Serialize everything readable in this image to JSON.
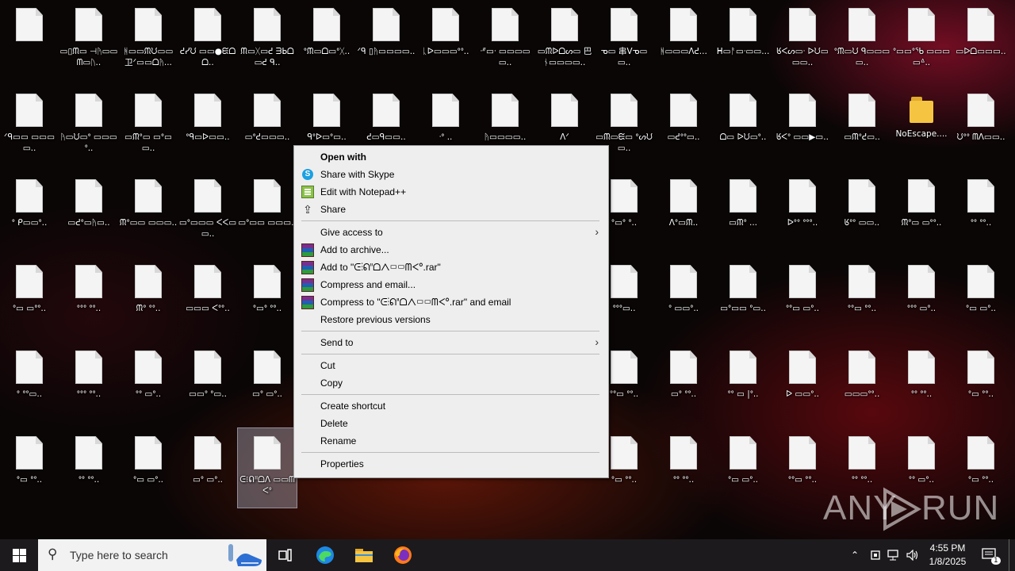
{
  "desktop": {
    "icons": [
      {
        "label": "",
        "type": "file",
        "col": 0,
        "row": 0,
        "blurred": true
      },
      {
        "label": "▭▯ᙏ▭ ⊣ᚤ▭▭ᗰ▭ᚢ..",
        "type": "file",
        "col": 1,
        "row": 0
      },
      {
        "label": "ᚻ▭▭ᙏᙀ▭▭ 卫ᐟ▭▭ᗝᚤ...",
        "type": "file",
        "col": 2,
        "row": 0
      },
      {
        "label": "ᕍᓯᙀ ▭▭●ᙓᗝᗝ..",
        "type": "file",
        "col": 3,
        "row": 0
      },
      {
        "label": "ᙏ▭ᚷ▭ᕍ ᗱᖯᗝ▭ᕍ ᑫ..",
        "type": "file",
        "col": 4,
        "row": 0
      },
      {
        "label": "ᐤᙏ▭ᗝ▭ᐤᚷ..",
        "type": "file",
        "col": 5,
        "row": 0
      },
      {
        "label": "ᐟᑫ ▯ᚤ▭▭▭▭..",
        "type": "file",
        "col": 6,
        "row": 0
      },
      {
        "label": "ᚳᐅ▭▭▭ᐤᐤ..",
        "type": "file",
        "col": 7,
        "row": 0
      },
      {
        "label": "ᐧᐥ▭ᐧ ▭▭▭▭▭..",
        "type": "file",
        "col": 8,
        "row": 0
      },
      {
        "label": "▭ᙏᐅᗝᔕ▭ 巴ᚾ▭▭▭▭..",
        "type": "file",
        "col": 9,
        "row": 0
      },
      {
        "label": "ᓀ▭ 串ᐯᓀ▭▭..",
        "type": "file",
        "col": 10,
        "row": 0
      },
      {
        "label": "ᚻ▭▭▭ᐱᕍ...",
        "type": "file",
        "col": 11,
        "row": 0
      },
      {
        "label": "ᕼ▭ᚨ▭ᐧ▭▭...",
        "type": "file",
        "col": 12,
        "row": 0
      },
      {
        "label": "ᖉᐸᔕ▭ᐧ ᐅᙀ▭▭▭..",
        "type": "file",
        "col": 13,
        "row": 0
      },
      {
        "label": "ᐤᙏ▭ᙀ ᑫ▭▭▭▭..",
        "type": "file",
        "col": 14,
        "row": 0
      },
      {
        "label": "ᐤ▭▭ᐤᖃ ▭▭▭▭ᐞ..",
        "type": "file",
        "col": 15,
        "row": 0
      },
      {
        "label": "▭ᐅᗝ▭▭▭..",
        "type": "file",
        "col": 16,
        "row": 0
      },
      {
        "label": "ᐟᑫ▭▭ ▭▭▭▭..",
        "type": "file",
        "col": 0,
        "row": 1
      },
      {
        "label": "ᚤ▭ᙀ▭ᐤ ▭▭▭ᐤ..",
        "type": "file",
        "col": 1,
        "row": 1
      },
      {
        "label": "▭ᙏᐤ▭ ▭ᐤ▭▭..",
        "type": "file",
        "col": 2,
        "row": 1
      },
      {
        "label": "ᐤᑫ▭ᐅ▭▭..",
        "type": "file",
        "col": 3,
        "row": 1
      },
      {
        "label": "▭ᐤᕍ▭▭▭..",
        "type": "file",
        "col": 4,
        "row": 1
      },
      {
        "label": "ᑫᐤᐅ▭ᐤ▭..",
        "type": "file",
        "col": 5,
        "row": 1
      },
      {
        "label": "ᕍ▭ᑫ▭▭..",
        "type": "file",
        "col": 6,
        "row": 1
      },
      {
        "label": "ᐧᐤ ..",
        "type": "file",
        "col": 7,
        "row": 1
      },
      {
        "label": "ᚤ▭▭▭▭..",
        "type": "file",
        "col": 8,
        "row": 1
      },
      {
        "label": "ᐱᐟ",
        "type": "file",
        "col": 9,
        "row": 1
      },
      {
        "label": "▭ᙏ▭ᙓ▭ ᐤᔕᙀ▭..",
        "type": "file",
        "col": 10,
        "row": 1
      },
      {
        "label": "▭ᕍᐤᐤ▭..",
        "type": "file",
        "col": 11,
        "row": 1
      },
      {
        "label": "ᗝ▭ ᐅᙀ▭ᐤ..",
        "type": "file",
        "col": 12,
        "row": 1
      },
      {
        "label": "ᖉᐸᐤ ▭▭▶▭..",
        "type": "file",
        "col": 13,
        "row": 1
      },
      {
        "label": "▭ᙏᐤᕍ▭..",
        "type": "file",
        "col": 14,
        "row": 1
      },
      {
        "label": "NoEscape....",
        "type": "folder",
        "col": 15,
        "row": 1
      },
      {
        "label": "ᙀᐤᐤ ᗰᐱ▭▭..",
        "type": "file",
        "col": 16,
        "row": 1
      },
      {
        "label": "ᐤ ᑭ▭▭ᐤ..",
        "type": "file",
        "col": 0,
        "row": 2
      },
      {
        "label": "▭ᕍᐤ▭ᚤ▭..",
        "type": "file",
        "col": 1,
        "row": 2
      },
      {
        "label": "ᙏᐤ▭▭ ▭▭▭..",
        "type": "file",
        "col": 2,
        "row": 2
      },
      {
        "label": "▭ᐤ▭▭▭ ᐸᐸ▭▭..",
        "type": "file",
        "col": 3,
        "row": 2
      },
      {
        "label": "▭ᐤ▭▭ ▭▭▭..",
        "type": "file",
        "col": 4,
        "row": 2
      },
      {
        "label": "ᐤ▭ᐤ ᐤ..",
        "type": "file",
        "col": 10,
        "row": 2
      },
      {
        "label": "ᐱᐤ▭ᙏ..",
        "type": "file",
        "col": 11,
        "row": 2
      },
      {
        "label": "▭ᙏᐤ ...",
        "type": "file",
        "col": 12,
        "row": 2
      },
      {
        "label": "ᐅᐤᐤ ᐤᐤᐤ..",
        "type": "file",
        "col": 13,
        "row": 2
      },
      {
        "label": "ᖉᐤᐤ ▭▭..",
        "type": "file",
        "col": 14,
        "row": 2
      },
      {
        "label": "ᙏᐤ▭ ▭ᐤᐤ..",
        "type": "file",
        "col": 15,
        "row": 2
      },
      {
        "label": "ᐤᐤ ᐤᐤ..",
        "type": "file",
        "col": 16,
        "row": 2
      },
      {
        "label": "ᐤ▭ ▭ᐤᐤ..",
        "type": "file",
        "col": 0,
        "row": 3
      },
      {
        "label": "ᐤᐤᐤ ᐤᐤ..",
        "type": "file",
        "col": 1,
        "row": 3
      },
      {
        "label": "ᙏᐤ ᐤᐤ..",
        "type": "file",
        "col": 2,
        "row": 3
      },
      {
        "label": "▭▭▭ ᐸᐤᐤ..",
        "type": "file",
        "col": 3,
        "row": 3
      },
      {
        "label": "ᐤ▭ᐤ ᐤᐤ..",
        "type": "file",
        "col": 4,
        "row": 3
      },
      {
        "label": "ᐤᐤᐤ▭..",
        "type": "file",
        "col": 10,
        "row": 3
      },
      {
        "label": "ᐤ ▭▭ᐤ..",
        "type": "file",
        "col": 11,
        "row": 3
      },
      {
        "label": "▭ᐤ▭▭ ᐤ▭..",
        "type": "file",
        "col": 12,
        "row": 3
      },
      {
        "label": "ᐤᐤ▭ ▭ᐤ..",
        "type": "file",
        "col": 13,
        "row": 3
      },
      {
        "label": "ᐤᐤ▭ ᐤᐤ..",
        "type": "file",
        "col": 14,
        "row": 3
      },
      {
        "label": "ᐤᐤᐤ ▭ᐤ..",
        "type": "file",
        "col": 15,
        "row": 3
      },
      {
        "label": "ᐤ▭ ▭ᐤ..",
        "type": "file",
        "col": 16,
        "row": 3
      },
      {
        "label": "ᐤ ᐤᐤ▭..",
        "type": "file",
        "col": 0,
        "row": 4
      },
      {
        "label": "ᐤᐤᐤ ᐤᐤ..",
        "type": "file",
        "col": 1,
        "row": 4
      },
      {
        "label": "ᐤᐤ ▭ᐤ..",
        "type": "file",
        "col": 2,
        "row": 4
      },
      {
        "label": "▭▭ᐤ ᐤ▭..",
        "type": "file",
        "col": 3,
        "row": 4
      },
      {
        "label": "▭ᐤ ▭ᐤ..",
        "type": "file",
        "col": 4,
        "row": 4
      },
      {
        "label": "ᐤᐤ▭ ᐤᐤ..",
        "type": "file",
        "col": 10,
        "row": 4
      },
      {
        "label": "▭ᐤ ᐤᐤ..",
        "type": "file",
        "col": 11,
        "row": 4
      },
      {
        "label": "ᐤᐤ ▭ |ᐤ..",
        "type": "file",
        "col": 12,
        "row": 4
      },
      {
        "label": "ᐅ ▭▭ᐤ..",
        "type": "file",
        "col": 13,
        "row": 4
      },
      {
        "label": "▭▭▭ᐤᐤ..",
        "type": "file",
        "col": 14,
        "row": 4
      },
      {
        "label": "ᐤᐤ ᐤᐤ..",
        "type": "file",
        "col": 15,
        "row": 4
      },
      {
        "label": "ᐤ▭ ᐤᐤ..",
        "type": "file",
        "col": 16,
        "row": 4
      },
      {
        "label": "ᐤ▭ ᐤᐤ..",
        "type": "file",
        "col": 0,
        "row": 5
      },
      {
        "label": "ᐤᐤ ᐤᐤ..",
        "type": "file",
        "col": 1,
        "row": 5
      },
      {
        "label": "ᐤ▭ ▭ᐤ..",
        "type": "file",
        "col": 2,
        "row": 5
      },
      {
        "label": "▭ᐤ ▭ᐤ..",
        "type": "file",
        "col": 3,
        "row": 5
      },
      {
        "label": "ᕮ⁝ᕠᐦᗝᐱ ▭▭ᗰᐸᐤ",
        "type": "file",
        "col": 4,
        "row": 5,
        "selected": true
      },
      {
        "label": "ᐤ▭ ᐤᐤ..",
        "type": "file",
        "col": 10,
        "row": 5
      },
      {
        "label": "ᐤᐤ ᐤᐤ..",
        "type": "file",
        "col": 11,
        "row": 5
      },
      {
        "label": "ᐤ▭ ▭ᐤ..",
        "type": "file",
        "col": 12,
        "row": 5
      },
      {
        "label": "ᐤᐤ▭ ᐤᐤ..",
        "type": "file",
        "col": 13,
        "row": 5
      },
      {
        "label": "ᐤᐤ ᐤᐤ..",
        "type": "file",
        "col": 14,
        "row": 5
      },
      {
        "label": "ᐤᐤ ▭ᐤ..",
        "type": "file",
        "col": 15,
        "row": 5
      },
      {
        "label": "ᐤ▭ ᐤᐤ..",
        "type": "file",
        "col": 16,
        "row": 5
      }
    ]
  },
  "context_menu": {
    "items": [
      {
        "kind": "item",
        "label": "Open with",
        "bold": true,
        "icon": ""
      },
      {
        "kind": "item",
        "label": "Share with Skype",
        "icon": "skype-icon"
      },
      {
        "kind": "item",
        "label": "Edit with Notepad++",
        "icon": "notepad-plus-plus-icon"
      },
      {
        "kind": "item",
        "label": "Share",
        "icon": "share-icon"
      },
      {
        "kind": "sep"
      },
      {
        "kind": "item",
        "label": "Give access to",
        "icon": "",
        "submenu": true
      },
      {
        "kind": "item",
        "label": "Add to archive...",
        "icon": "winrar-icon"
      },
      {
        "kind": "item",
        "label": "Add to \"ᕮ⁝ᕠᐦᗝᐱ▭▭ᗰᐸᐤ.rar\"",
        "icon": "winrar-icon"
      },
      {
        "kind": "item",
        "label": "Compress and email...",
        "icon": "winrar-icon"
      },
      {
        "kind": "item",
        "label": "Compress to \"ᕮ⁝ᕠᐦᗝᐱ▭▭ᗰᐸᐤ.rar\" and email",
        "icon": "winrar-icon"
      },
      {
        "kind": "item",
        "label": "Restore previous versions",
        "icon": ""
      },
      {
        "kind": "sep"
      },
      {
        "kind": "item",
        "label": "Send to",
        "icon": "",
        "submenu": true
      },
      {
        "kind": "sep"
      },
      {
        "kind": "item",
        "label": "Cut",
        "icon": ""
      },
      {
        "kind": "item",
        "label": "Copy",
        "icon": ""
      },
      {
        "kind": "sep"
      },
      {
        "kind": "item",
        "label": "Create shortcut",
        "icon": ""
      },
      {
        "kind": "item",
        "label": "Delete",
        "icon": ""
      },
      {
        "kind": "item",
        "label": "Rename",
        "icon": ""
      },
      {
        "kind": "sep"
      },
      {
        "kind": "item",
        "label": "Properties",
        "icon": ""
      }
    ]
  },
  "taskbar": {
    "search_placeholder": "Type here to search",
    "time": "4:55 PM",
    "date": "1/8/2025",
    "notification_count": "1",
    "pinned": [
      "task-view-icon",
      "edge-icon",
      "file-explorer-icon",
      "firefox-icon"
    ]
  },
  "watermark": {
    "left": "ANY",
    "right": "RUN"
  }
}
